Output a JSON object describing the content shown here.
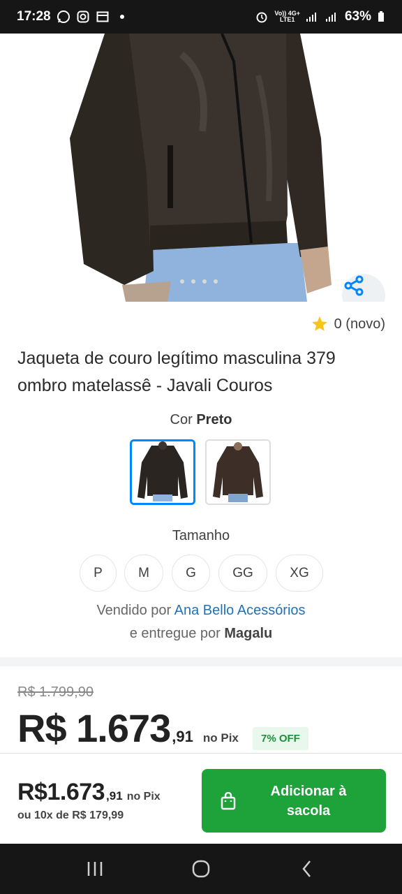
{
  "status_bar": {
    "time": "17:28",
    "battery": "63%",
    "network_top": "Vo)) 4G+",
    "network_bottom": "LTE1"
  },
  "product": {
    "rating_score": "0 (novo)",
    "title": "Jaqueta de couro legítimo masculina 379 ombro matelassê - Javali Couros",
    "color_label": "Cor",
    "color_value": "Preto",
    "swatches": [
      {
        "name": "Preto",
        "selected": true
      },
      {
        "name": "Marrom",
        "selected": false
      }
    ],
    "size_label": "Tamanho",
    "sizes": [
      "P",
      "M",
      "G",
      "GG",
      "XG"
    ],
    "seller_prefix": "Vendido por",
    "seller_name": "Ana Bello Acessórios",
    "delivery_prefix": "e entregue por",
    "delivery_name": "Magalu",
    "image_dots_count": 4
  },
  "pricing": {
    "old_price": "R$ 1.799,90",
    "price_main": "R$ 1.673",
    "price_cents": ",91",
    "price_method": "no Pix",
    "discount_badge": "7% OFF"
  },
  "footer": {
    "price_main": "R$1.673",
    "price_cents": ",91",
    "price_method": "no Pix",
    "installments": "ou 10x de R$ 179,99",
    "add_button_line1": "Adicionar à",
    "add_button_line2": "sacola"
  },
  "colors": {
    "accent_blue": "#0086ff",
    "link_blue": "#1f72b8",
    "buy_green": "#1ea33a",
    "star_yellow": "#f5c518",
    "discount_green": "#1e8f3a"
  }
}
